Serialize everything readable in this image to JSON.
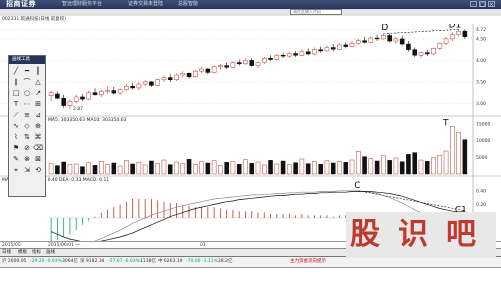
{
  "app": {
    "brand": "招商证券",
    "menus": [
      "智远理财服务平台",
      "证券交易未登陆",
      "总股智能"
    ]
  },
  "toolbar": {
    "code_placeholder": "请在此输入代码"
  },
  "stock": {
    "title": "002331 皖通科技(日线 前复权)"
  },
  "price_axis": [
    {
      "label": "4.72",
      "v": 4.72
    },
    {
      "label": "4.50",
      "v": 4.5
    },
    {
      "label": "4.00",
      "v": 4.0
    },
    {
      "label": "3.50",
      "v": 3.5
    },
    {
      "label": "3.00",
      "v": 3.0
    }
  ],
  "price_low_label": "2.87",
  "volume_indicator": "MA5: 303350.63 MA10: 303350.63",
  "volume_axis": [
    "15000",
    "10000",
    "5000"
  ],
  "macd_indicator": "MACD(12,26,9) DIF: 0.40 DEA: 0.33 MACD: 0.11",
  "macd_axis": [
    "0.40",
    "0.20",
    "0.00",
    "-0.20"
  ],
  "drawing_panel": {
    "title": "画线工具",
    "tools": [
      "╱",
      "━",
      "┃",
      "∥",
      "⌒",
      "△",
      "□",
      "○",
      "↗",
      "T",
      "⋯",
      "⊞",
      "⟋",
      "≡",
      "⊿",
      "∿",
      "◇",
      "⊕",
      "⌇",
      "⇅",
      "⌘",
      "⚑",
      "⊘",
      "⌫",
      "✎",
      "⊗",
      "⊠",
      "⌖",
      "⇲",
      "⟲"
    ]
  },
  "annotations": {
    "D": "D",
    "D1": "D1",
    "T": "T",
    "C": "C",
    "C1": "C1"
  },
  "date_axis": [
    "2015/05",
    "2015/06/01 一",
    "01",
    "01"
  ],
  "tabs": [
    "日线",
    "模板",
    "指标",
    "画线"
  ],
  "status_text": [
    "沪 2600.95",
    "-29.20",
    "-0.93%",
    "3064亿",
    "深 9182.34",
    "-57.67",
    "-0.63%",
    "1138亿",
    "中 6263.19",
    "-70.06",
    "-1.11%",
    "28.2亿"
  ],
  "status_tip": "主力资金流向提示",
  "watermark": {
    "text": [
      "股",
      "识",
      "吧"
    ]
  },
  "colors": {
    "up": "#c0392b",
    "down": "#111111",
    "dif": "#888888",
    "dea": "#111111"
  },
  "chart_data": {
    "type": "candlestick",
    "candles": [
      {
        "o": 3.18,
        "h": 3.3,
        "l": 3.05,
        "c": 3.25
      },
      {
        "o": 3.22,
        "h": 3.28,
        "l": 3.1,
        "c": 3.12
      },
      {
        "o": 3.12,
        "h": 3.2,
        "l": 2.9,
        "c": 2.95
      },
      {
        "o": 2.95,
        "h": 3.1,
        "l": 2.87,
        "c": 3.05
      },
      {
        "o": 3.05,
        "h": 3.2,
        "l": 3.0,
        "c": 3.15
      },
      {
        "o": 3.15,
        "h": 3.22,
        "l": 3.05,
        "c": 3.1
      },
      {
        "o": 3.1,
        "h": 3.3,
        "l": 3.08,
        "c": 3.25
      },
      {
        "o": 3.25,
        "h": 3.35,
        "l": 3.18,
        "c": 3.2
      },
      {
        "o": 3.2,
        "h": 3.32,
        "l": 3.15,
        "c": 3.28
      },
      {
        "o": 3.28,
        "h": 3.4,
        "l": 3.22,
        "c": 3.3
      },
      {
        "o": 3.3,
        "h": 3.38,
        "l": 3.2,
        "c": 3.24
      },
      {
        "o": 3.24,
        "h": 3.35,
        "l": 3.2,
        "c": 3.32
      },
      {
        "o": 3.32,
        "h": 3.45,
        "l": 3.28,
        "c": 3.4
      },
      {
        "o": 3.4,
        "h": 3.48,
        "l": 3.32,
        "c": 3.36
      },
      {
        "o": 3.36,
        "h": 3.5,
        "l": 3.3,
        "c": 3.45
      },
      {
        "o": 3.45,
        "h": 3.55,
        "l": 3.4,
        "c": 3.5
      },
      {
        "o": 3.5,
        "h": 3.52,
        "l": 3.38,
        "c": 3.42
      },
      {
        "o": 3.42,
        "h": 3.58,
        "l": 3.4,
        "c": 3.55
      },
      {
        "o": 3.55,
        "h": 3.65,
        "l": 3.5,
        "c": 3.6
      },
      {
        "o": 3.6,
        "h": 3.68,
        "l": 3.5,
        "c": 3.55
      },
      {
        "o": 3.55,
        "h": 3.7,
        "l": 3.52,
        "c": 3.66
      },
      {
        "o": 3.66,
        "h": 3.75,
        "l": 3.6,
        "c": 3.7
      },
      {
        "o": 3.7,
        "h": 3.72,
        "l": 3.58,
        "c": 3.62
      },
      {
        "o": 3.62,
        "h": 3.78,
        "l": 3.6,
        "c": 3.75
      },
      {
        "o": 3.75,
        "h": 3.85,
        "l": 3.7,
        "c": 3.8
      },
      {
        "o": 3.8,
        "h": 3.82,
        "l": 3.68,
        "c": 3.72
      },
      {
        "o": 3.72,
        "h": 3.88,
        "l": 3.7,
        "c": 3.85
      },
      {
        "o": 3.85,
        "h": 3.92,
        "l": 3.78,
        "c": 3.88
      },
      {
        "o": 3.88,
        "h": 3.95,
        "l": 3.8,
        "c": 3.84
      },
      {
        "o": 3.84,
        "h": 3.98,
        "l": 3.82,
        "c": 3.95
      },
      {
        "o": 3.95,
        "h": 4.02,
        "l": 3.88,
        "c": 3.92
      },
      {
        "o": 3.92,
        "h": 4.05,
        "l": 3.9,
        "c": 4.0
      },
      {
        "o": 4.0,
        "h": 4.05,
        "l": 3.85,
        "c": 3.88
      },
      {
        "o": 3.88,
        "h": 3.98,
        "l": 3.82,
        "c": 3.95
      },
      {
        "o": 3.95,
        "h": 4.08,
        "l": 3.92,
        "c": 4.05
      },
      {
        "o": 4.05,
        "h": 4.12,
        "l": 3.98,
        "c": 4.02
      },
      {
        "o": 4.02,
        "h": 4.15,
        "l": 4.0,
        "c": 4.12
      },
      {
        "o": 4.12,
        "h": 4.18,
        "l": 4.05,
        "c": 4.1
      },
      {
        "o": 4.1,
        "h": 4.2,
        "l": 4.06,
        "c": 4.16
      },
      {
        "o": 4.16,
        "h": 4.22,
        "l": 4.08,
        "c": 4.12
      },
      {
        "o": 4.12,
        "h": 4.25,
        "l": 4.1,
        "c": 4.2
      },
      {
        "o": 4.2,
        "h": 4.28,
        "l": 4.12,
        "c": 4.15
      },
      {
        "o": 4.15,
        "h": 4.3,
        "l": 4.12,
        "c": 4.25
      },
      {
        "o": 4.25,
        "h": 4.32,
        "l": 4.18,
        "c": 4.22
      },
      {
        "o": 4.22,
        "h": 4.35,
        "l": 4.2,
        "c": 4.3
      },
      {
        "o": 4.3,
        "h": 4.38,
        "l": 4.22,
        "c": 4.26
      },
      {
        "o": 4.26,
        "h": 4.4,
        "l": 4.24,
        "c": 4.36
      },
      {
        "o": 4.36,
        "h": 4.42,
        "l": 4.28,
        "c": 4.32
      },
      {
        "o": 4.32,
        "h": 4.45,
        "l": 4.3,
        "c": 4.4
      },
      {
        "o": 4.4,
        "h": 4.5,
        "l": 4.36,
        "c": 4.46
      },
      {
        "o": 4.46,
        "h": 4.55,
        "l": 4.4,
        "c": 4.42
      },
      {
        "o": 4.42,
        "h": 4.56,
        "l": 4.4,
        "c": 4.52
      },
      {
        "o": 4.52,
        "h": 4.6,
        "l": 4.45,
        "c": 4.5
      },
      {
        "o": 4.5,
        "h": 4.62,
        "l": 4.48,
        "c": 4.58
      },
      {
        "o": 4.58,
        "h": 4.62,
        "l": 4.42,
        "c": 4.45
      },
      {
        "o": 4.45,
        "h": 4.55,
        "l": 4.38,
        "c": 4.5
      },
      {
        "o": 4.5,
        "h": 4.58,
        "l": 4.35,
        "c": 4.38
      },
      {
        "o": 4.38,
        "h": 4.45,
        "l": 4.2,
        "c": 4.25
      },
      {
        "o": 4.25,
        "h": 4.3,
        "l": 4.08,
        "c": 4.12
      },
      {
        "o": 4.12,
        "h": 4.2,
        "l": 4.05,
        "c": 4.18
      },
      {
        "o": 4.18,
        "h": 4.25,
        "l": 4.1,
        "c": 4.15
      },
      {
        "o": 4.15,
        "h": 4.3,
        "l": 4.12,
        "c": 4.28
      },
      {
        "o": 4.28,
        "h": 4.42,
        "l": 4.25,
        "c": 4.4
      },
      {
        "o": 4.4,
        "h": 4.55,
        "l": 4.35,
        "c": 4.5
      },
      {
        "o": 4.5,
        "h": 4.65,
        "l": 4.45,
        "c": 4.6
      },
      {
        "o": 4.6,
        "h": 4.72,
        "l": 4.55,
        "c": 4.68
      },
      {
        "o": 4.68,
        "h": 4.72,
        "l": 4.5,
        "c": 4.55
      }
    ],
    "volume": [
      3.1,
      2.5,
      3.6,
      2.8,
      3.0,
      2.2,
      3.4,
      2.6,
      3.8,
      2.9,
      3.3,
      2.4,
      4.1,
      3.0,
      3.5,
      2.7,
      3.9,
      3.2,
      4.2,
      2.8,
      3.6,
      3.1,
      4.4,
      2.9,
      3.7,
      3.3,
      4.0,
      2.6,
      3.5,
      3.8,
      2.9,
      4.3,
      3.2,
      3.6,
      2.7,
      4.1,
      3.0,
      3.9,
      2.8,
      3.4,
      4.5,
      3.1,
      3.7,
      2.9,
      4.0,
      3.3,
      3.8,
      3.5,
      4.2,
      6.8,
      5.2,
      4.6,
      3.9,
      5.5,
      4.1,
      4.8,
      3.7,
      5.9,
      6.4,
      4.2,
      3.8,
      4.9,
      5.6,
      6.9,
      14.2,
      12.5,
      10.3
    ],
    "macd_dif": [
      -0.38,
      -0.4,
      -0.42,
      -0.43,
      -0.42,
      -0.4,
      -0.37,
      -0.34,
      -0.3,
      -0.26,
      -0.22,
      -0.18,
      -0.13,
      -0.08,
      -0.04,
      0.0,
      0.04,
      0.07,
      0.1,
      0.13,
      0.16,
      0.18,
      0.2,
      0.22,
      0.24,
      0.26,
      0.28,
      0.29,
      0.3,
      0.31,
      0.32,
      0.33,
      0.34,
      0.34,
      0.35,
      0.35,
      0.36,
      0.36,
      0.37,
      0.37,
      0.38,
      0.38,
      0.38,
      0.39,
      0.39,
      0.39,
      0.4,
      0.4,
      0.4,
      0.4,
      0.39,
      0.38,
      0.36,
      0.33,
      0.3,
      0.26,
      0.22,
      0.17,
      0.12,
      0.08,
      0.05,
      0.03,
      0.02,
      0.01,
      0.03,
      0.08,
      0.11
    ],
    "macd_dea": [
      -0.2,
      -0.24,
      -0.28,
      -0.31,
      -0.33,
      -0.35,
      -0.35,
      -0.35,
      -0.34,
      -0.32,
      -0.3,
      -0.28,
      -0.25,
      -0.22,
      -0.18,
      -0.14,
      -0.1,
      -0.06,
      -0.02,
      0.02,
      0.05,
      0.08,
      0.11,
      0.14,
      0.16,
      0.18,
      0.2,
      0.22,
      0.24,
      0.25,
      0.27,
      0.28,
      0.29,
      0.3,
      0.31,
      0.32,
      0.33,
      0.33,
      0.34,
      0.35,
      0.35,
      0.36,
      0.36,
      0.37,
      0.37,
      0.38,
      0.38,
      0.38,
      0.39,
      0.39,
      0.39,
      0.39,
      0.38,
      0.37,
      0.36,
      0.34,
      0.32,
      0.29,
      0.26,
      0.23,
      0.2,
      0.17,
      0.14,
      0.12,
      0.1,
      0.09,
      0.09
    ]
  }
}
